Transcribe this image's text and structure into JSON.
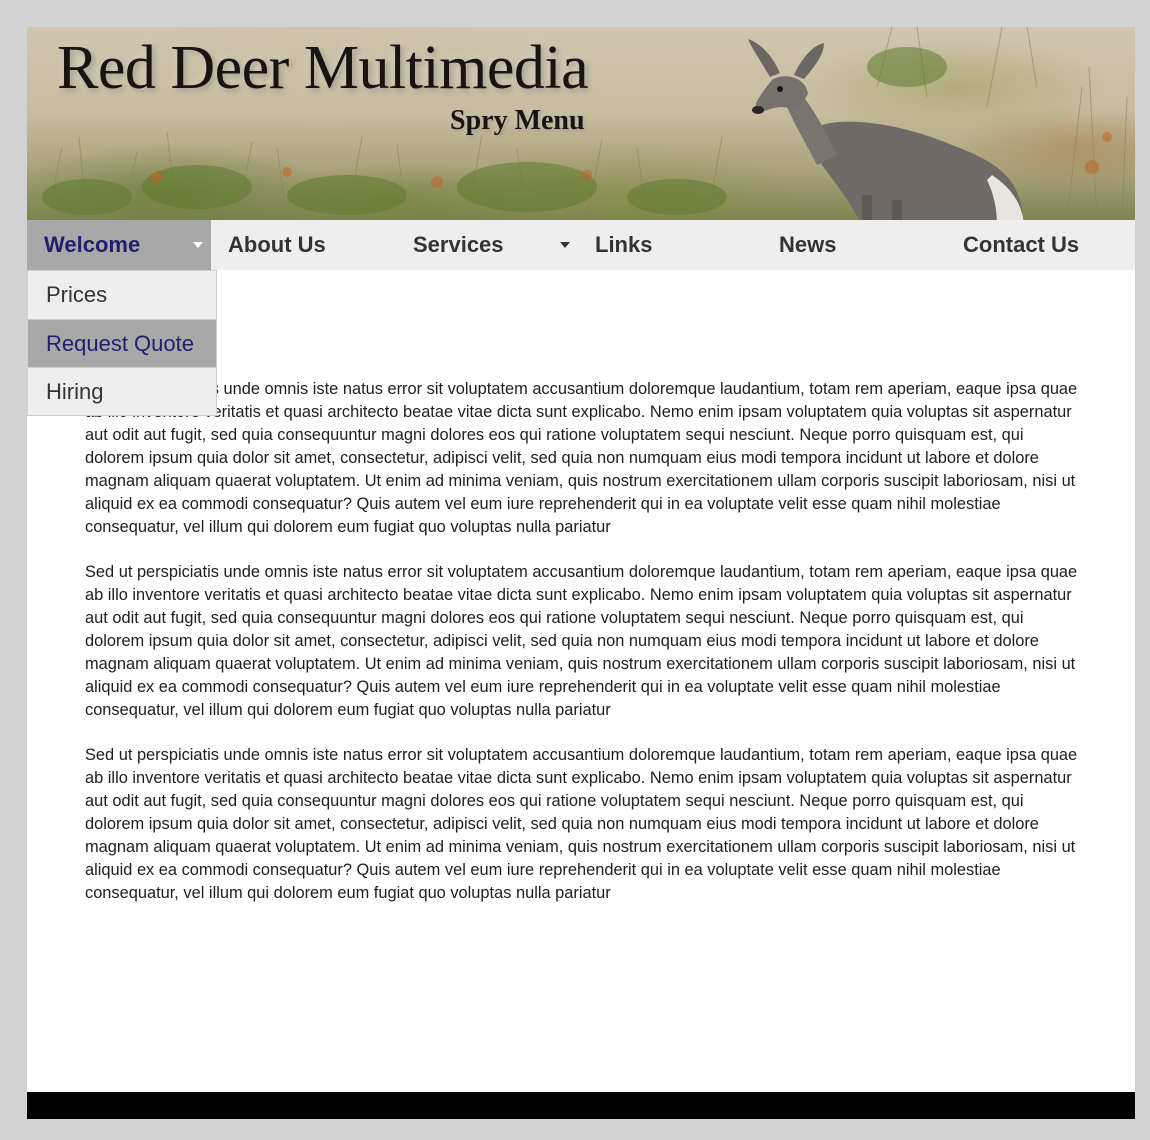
{
  "header": {
    "title": "Red Deer Multimedia",
    "subtitle": "Spry Menu"
  },
  "menu": {
    "items": [
      {
        "label": "Welcome",
        "has_submenu": true,
        "active": true
      },
      {
        "label": "About Us",
        "has_submenu": false
      },
      {
        "label": "Services",
        "has_submenu": true
      },
      {
        "label": "Links",
        "has_submenu": false
      },
      {
        "label": "News",
        "has_submenu": false
      },
      {
        "label": "Contact Us",
        "has_submenu": false
      }
    ],
    "submenu": [
      {
        "label": "Prices"
      },
      {
        "label": "Request Quote",
        "hover": true
      },
      {
        "label": "Hiring"
      }
    ]
  },
  "content": {
    "paragraphs": [
      "Sed ut perspiciatis unde omnis iste natus error sit voluptatem accusantium doloremque laudantium, totam rem aperiam, eaque ipsa quae ab illo inventore veritatis et quasi architecto beatae vitae dicta sunt explicabo. Nemo enim ipsam voluptatem quia voluptas sit aspernatur aut odit aut fugit, sed quia consequuntur magni dolores eos qui ratione voluptatem sequi nesciunt. Neque porro quisquam est, qui dolorem ipsum quia dolor sit amet, consectetur, adipisci velit, sed quia non numquam eius modi tempora incidunt ut labore et dolore magnam aliquam quaerat voluptatem. Ut enim ad minima veniam, quis nostrum exercitationem ullam corporis suscipit laboriosam, nisi ut aliquid ex ea commodi consequatur? Quis autem vel eum iure reprehenderit qui in ea voluptate velit esse quam nihil molestiae consequatur, vel illum qui dolorem eum fugiat quo voluptas nulla pariatur",
      "Sed ut perspiciatis unde omnis iste natus error sit voluptatem accusantium doloremque laudantium, totam rem aperiam, eaque ipsa quae ab illo inventore veritatis et quasi architecto beatae vitae dicta sunt explicabo. Nemo enim ipsam voluptatem quia voluptas sit aspernatur aut odit aut fugit, sed quia consequuntur magni dolores eos qui ratione voluptatem sequi nesciunt. Neque porro quisquam est, qui dolorem ipsum quia dolor sit amet, consectetur, adipisci velit, sed quia non numquam eius modi tempora incidunt ut labore et dolore magnam aliquam quaerat voluptatem. Ut enim ad minima veniam, quis nostrum exercitationem ullam corporis suscipit laboriosam, nisi ut aliquid ex ea commodi consequatur? Quis autem vel eum iure reprehenderit qui in ea voluptate velit esse quam nihil molestiae consequatur, vel illum qui dolorem eum fugiat quo voluptas nulla pariatur",
      "Sed ut perspiciatis unde omnis iste natus error sit voluptatem accusantium doloremque laudantium, totam rem aperiam, eaque ipsa quae ab illo inventore veritatis et quasi architecto beatae vitae dicta sunt explicabo. Nemo enim ipsam voluptatem quia voluptas sit aspernatur aut odit aut fugit, sed quia consequuntur magni dolores eos qui ratione voluptatem sequi nesciunt. Neque porro quisquam est, qui dolorem ipsum quia dolor sit amet, consectetur, adipisci velit, sed quia non numquam eius modi tempora incidunt ut labore et dolore magnam aliquam quaerat voluptatem. Ut enim ad minima veniam, quis nostrum exercitationem ullam corporis suscipit laboriosam, nisi ut aliquid ex ea commodi consequatur? Quis autem vel eum iure reprehenderit qui in ea voluptate velit esse quam nihil molestiae consequatur, vel illum qui dolorem eum fugiat quo voluptas nulla pariatur"
    ]
  },
  "icons": {
    "submenu_indicator": "chevron-down-icon",
    "banner_image": "deer-photo"
  },
  "colors": {
    "page_background": "#d2d2d2",
    "menu_background": "#eeeeee",
    "menu_active_background": "#a8a8a8",
    "menu_active_text": "#1f1f6e",
    "menu_text": "#333333",
    "footer": "#000000"
  }
}
